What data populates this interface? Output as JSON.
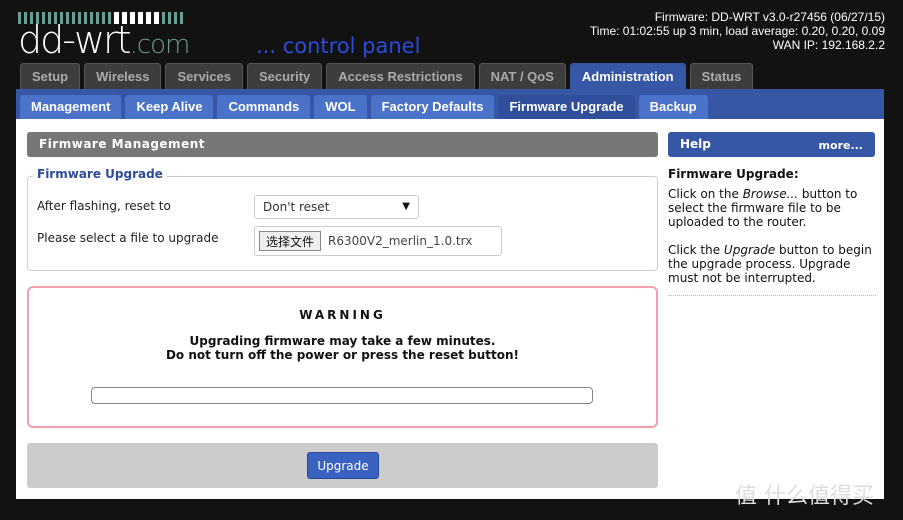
{
  "header": {
    "logo": "dd-wrt.com",
    "logo_main": "dd-wrt",
    "logo_suffix": ".com",
    "tagline": "... control panel",
    "firmware": "Firmware: DD-WRT v3.0-r27456 (06/27/15)",
    "time": "Time: 01:02:55 up 3 min, load average: 0.20, 0.20, 0.09",
    "wan_ip": "WAN IP: 192.168.2.2"
  },
  "top_tabs": [
    "Setup",
    "Wireless",
    "Services",
    "Security",
    "Access Restrictions",
    "NAT / QoS",
    "Administration",
    "Status"
  ],
  "active_top_tab": "Administration",
  "sub_tabs": [
    "Management",
    "Keep Alive",
    "Commands",
    "WOL",
    "Factory Defaults",
    "Firmware Upgrade",
    "Backup"
  ],
  "active_sub_tab": "Firmware Upgrade",
  "main": {
    "section_title": "Firmware Management",
    "fieldset_legend": "Firmware Upgrade",
    "reset_label": "After flashing, reset to",
    "reset_value": "Don't reset",
    "file_label": "Please select a file to upgrade",
    "file_button": "选择文件",
    "file_name": "R6300V2_merlin_1.0.trx",
    "warning_title": "WARNING",
    "warning_line1": "Upgrading firmware may take a few minutes.",
    "warning_line2": "Do not turn off the power or press the reset button!",
    "progress": 0,
    "upgrade_button": "Upgrade"
  },
  "help": {
    "title": "Help",
    "more": "more...",
    "heading": "Firmware Upgrade:",
    "p1_a": "Click on the ",
    "p1_em": "Browse...",
    "p1_b": " button to select the firmware file to be uploaded to the router.",
    "p2_a": "Click the ",
    "p2_em": "Upgrade",
    "p2_b": " button to begin the upgrade process. Upgrade must not be interrupted."
  },
  "watermark": "值 什么值得买",
  "colors": {
    "accent": "#3656a6",
    "warning_border": "#f0a0a8"
  }
}
